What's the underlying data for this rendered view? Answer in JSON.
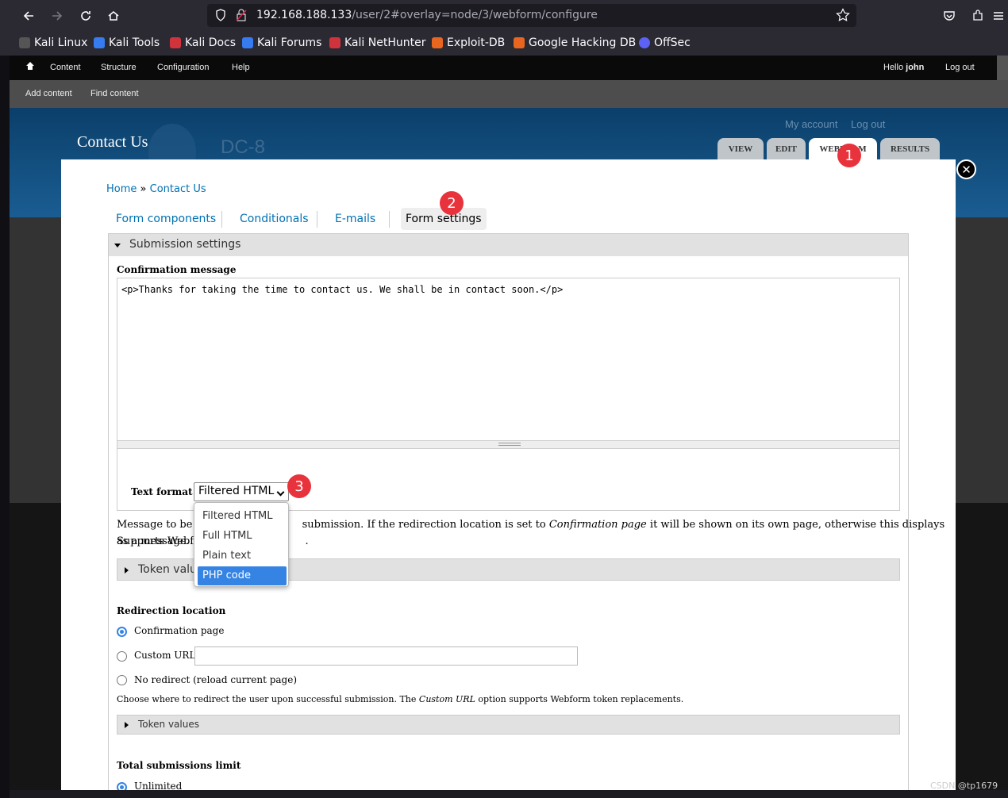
{
  "browser": {
    "url_host": "192.168.188.133",
    "url_path": "/user/2#overlay=node/3/webform/configure",
    "bookmarks": [
      {
        "label": "Kali Linux",
        "color": "#3a3a3a"
      },
      {
        "label": "Kali Tools",
        "color": "#367bf0"
      },
      {
        "label": "Kali Docs",
        "color": "#d1333d"
      },
      {
        "label": "Kali Forums",
        "color": "#367bf0"
      },
      {
        "label": "Kali NetHunter",
        "color": "#d1333d"
      },
      {
        "label": "Exploit-DB",
        "color": "#e8661f"
      },
      {
        "label": "Google Hacking DB",
        "color": "#e8661f"
      },
      {
        "label": "OffSec",
        "color": "#5b62f5"
      }
    ]
  },
  "admin": {
    "menu": [
      "Content",
      "Structure",
      "Configuration",
      "Help"
    ],
    "hello": "Hello",
    "user": "john",
    "logout": "Log out",
    "shortcuts": [
      "Add content",
      "Find content"
    ]
  },
  "site": {
    "name": "Contact Us",
    "brand": "DC-8",
    "my_account": "My account",
    "log_out": "Log out",
    "tabs": [
      "VIEW",
      "EDIT",
      "WEBFORM",
      "RESULTS"
    ]
  },
  "overlay": {
    "breadcrumb_home": "Home",
    "breadcrumb_sep": "»",
    "breadcrumb_current": "Contact Us",
    "subtabs": [
      "Form components",
      "Conditionals",
      "E-mails",
      "Form settings"
    ],
    "fieldset_title": "Submission settings",
    "confirmation_label": "Confirmation message",
    "confirmation_value": "<p>Thanks for taking the time to contact us. We shall be in contact soon.</p>",
    "text_format_label": "Text format",
    "text_format_selected": "Filtered HTML",
    "text_format_options": [
      "Filtered HTML",
      "Full HTML",
      "Plain text",
      "PHP code"
    ],
    "help_line1_a": "Message to be sh",
    "help_line1_b": "submission. If the redirection location is set to",
    "help_line1_em": "Confirmation page",
    "help_line1_c": "it will be shown on its own page, otherwise this displays as a message.",
    "help_line2_a": "Supports Webforn",
    "help_line2_b": ".",
    "token_values_partial": "Token valu",
    "redirect_label": "Redirection location",
    "redirect_options": [
      "Confirmation page",
      "Custom URL:",
      "No redirect (reload current page)"
    ],
    "redirect_help_a": "Choose where to redirect the user upon successful submission. The",
    "redirect_help_em": "Custom URL",
    "redirect_help_b": "option supports Webform token replacements.",
    "token_values": "Token values",
    "limit_label": "Total submissions limit",
    "limit_option": "Unlimited"
  },
  "annotations": [
    "1",
    "2",
    "3"
  ],
  "watermark": "CSDN @tp1679"
}
